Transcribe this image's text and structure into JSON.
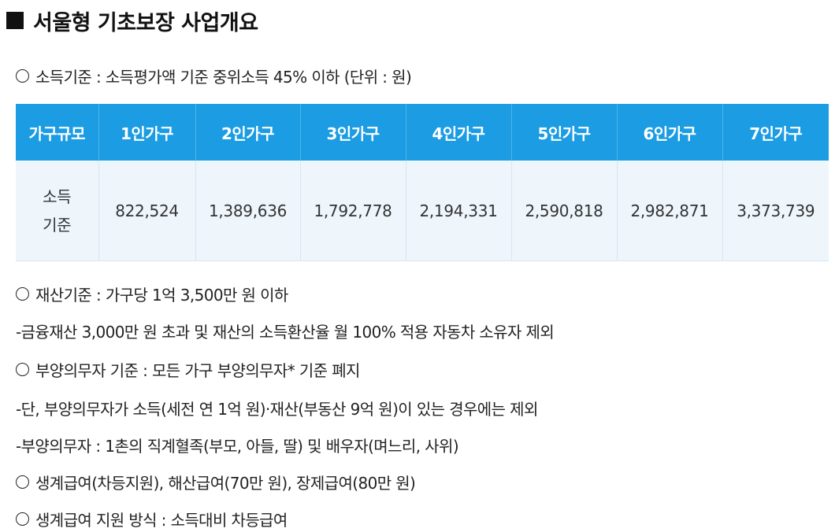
{
  "title": "서울형 기초보장 사업개요",
  "income_criteria_heading": "소득기준 : 소득평가액 기준 중위소득 45% 이하 (단위 : 원)",
  "income_table": {
    "headers": [
      "가구규모",
      "1인가구",
      "2인가구",
      "3인가구",
      "4인가구",
      "5인가구",
      "6인가구",
      "7인가구"
    ],
    "row_label": "소득 기준",
    "values": [
      "822,524",
      "1,389,636",
      "1,792,778",
      "2,194,331",
      "2,590,818",
      "2,982,871",
      "3,373,739"
    ]
  },
  "property_criteria_heading": "재산기준 : 가구당 1억 3,500만 원 이하",
  "property_criteria_note": "-금융재산 3,000만 원 초과 및 재산의 소득환산율 월 100% 적용 자동차 소유자 제외",
  "obligor_heading": "부양의무자 기준 : 모든 가구 부양의무자* 기준 폐지",
  "obligor_note_1": "-단, 부양의무자가 소득(세전 연 1억 원)·재산(부동산 9억 원)이 있는 경우에는 제외",
  "obligor_note_2": "-부양의무자 : 1촌의 직계혈족(부모, 아들, 딸) 및 배우자(며느리, 사위)",
  "benefits_heading": "생계급여(차등지원), 해산급여(70만 원), 장제급여(80만 원)",
  "support_method_heading": "생계급여 지원 방식 : 소득대비 차등급여"
}
